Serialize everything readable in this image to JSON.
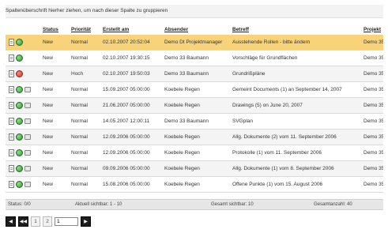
{
  "group_hint": "Spaltenüberschrift hierher ziehen, um nach dieser Spalte zu gruppieren",
  "columns": [
    "",
    "Status",
    "Priorität",
    "Erstellt am",
    "Absender",
    "Betreff",
    "Projekt"
  ],
  "rows": [
    {
      "status": "New",
      "priority": "Normal",
      "created": "02.10.2007 20:52:04",
      "sender": "Demo Dt Projektmanager",
      "subject": "Ausstehende Rollen - bitte ändern",
      "project": "Demo 35",
      "dot": "green",
      "clip": false,
      "selected": true
    },
    {
      "status": "New",
      "priority": "Normal",
      "created": "02.10.2007 19:30:15",
      "sender": "Demo 33 Baumann",
      "subject": "Vorschläge für Grundflächen",
      "project": "Demo 35",
      "dot": "green",
      "clip": false
    },
    {
      "status": "New",
      "priority": "Hoch",
      "created": "02.10.2007 19:50:03",
      "sender": "Demo 33 Baumann",
      "subject": "Grundrißpläne",
      "project": "Demo 35",
      "dot": "red",
      "clip": false
    },
    {
      "status": "New",
      "priority": "Normal",
      "created": "15.09.2007 05:00:00",
      "sender": "Koebele Regen",
      "subject": "Gemeint Documents (1) an September 14, 2007",
      "project": "Demo 35",
      "dot": "green",
      "clip": true
    },
    {
      "status": "New",
      "priority": "Normal",
      "created": "21.06.2007 05:00:00",
      "sender": "Koebele Regen",
      "subject": "Drawings (5) on June 20, 2007",
      "project": "Demo 35",
      "dot": "green",
      "clip": true
    },
    {
      "status": "New",
      "priority": "Normal",
      "created": "14.05.2007 12:00:11",
      "sender": "Demo 33 Baumann",
      "subject": "SVGplan",
      "project": "Demo 35",
      "dot": "green",
      "clip": true
    },
    {
      "status": "New",
      "priority": "Normal",
      "created": "12.09.2006 05:00:00",
      "sender": "Koebele Regen",
      "subject": "Allg. Dokumente (2) vom 11. September 2006",
      "project": "Demo 35",
      "dot": "green",
      "clip": true
    },
    {
      "status": "New",
      "priority": "Normal",
      "created": "12.09.2006 05:00:00",
      "sender": "Koebele Regen",
      "subject": "Protokolle (1) vom 11. September 2006",
      "project": "Demo 35",
      "dot": "green",
      "clip": true
    },
    {
      "status": "New",
      "priority": "Normal",
      "created": "09.09.2006 05:00:00",
      "sender": "Koebele Regen",
      "subject": "Allg. Dokumente (1) vom 8. September 2006",
      "project": "Demo 35",
      "dot": "green",
      "clip": true
    },
    {
      "status": "New",
      "priority": "Normal",
      "created": "15.08.2006 05:00:00",
      "sender": "Koebele Regen",
      "subject": "Offene Punkte (1) vom 15. August 2006",
      "project": "Demo 35",
      "dot": "green",
      "clip": true
    }
  ],
  "statusbar": {
    "status": "Status: 0/0",
    "current": "Aktuell sichtbar: 1 - 10",
    "total": "Gesamt sichtbar: 10",
    "selected": "Gesamtanzahl: 40"
  },
  "pager": {
    "first": "◀",
    "prev": "◀◀",
    "page1": "1",
    "page2": "2",
    "next": "▶",
    "goto_value": "1"
  }
}
